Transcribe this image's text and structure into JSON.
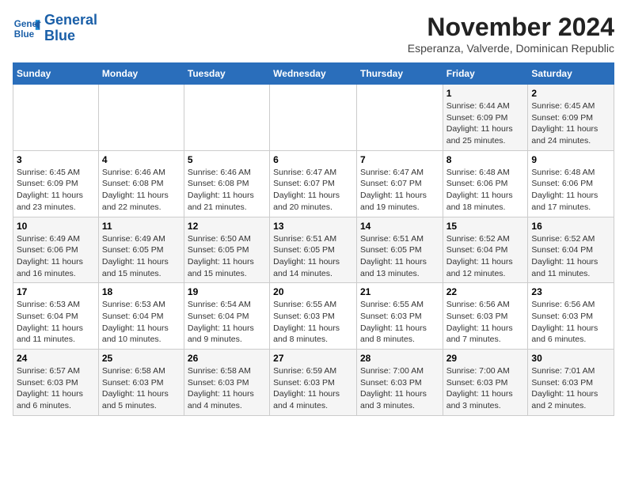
{
  "header": {
    "logo_line1": "General",
    "logo_line2": "Blue",
    "month_year": "November 2024",
    "location": "Esperanza, Valverde, Dominican Republic"
  },
  "days_of_week": [
    "Sunday",
    "Monday",
    "Tuesday",
    "Wednesday",
    "Thursday",
    "Friday",
    "Saturday"
  ],
  "weeks": [
    [
      {
        "day": "",
        "info": ""
      },
      {
        "day": "",
        "info": ""
      },
      {
        "day": "",
        "info": ""
      },
      {
        "day": "",
        "info": ""
      },
      {
        "day": "",
        "info": ""
      },
      {
        "day": "1",
        "info": "Sunrise: 6:44 AM\nSunset: 6:09 PM\nDaylight: 11 hours and 25 minutes."
      },
      {
        "day": "2",
        "info": "Sunrise: 6:45 AM\nSunset: 6:09 PM\nDaylight: 11 hours and 24 minutes."
      }
    ],
    [
      {
        "day": "3",
        "info": "Sunrise: 6:45 AM\nSunset: 6:09 PM\nDaylight: 11 hours and 23 minutes."
      },
      {
        "day": "4",
        "info": "Sunrise: 6:46 AM\nSunset: 6:08 PM\nDaylight: 11 hours and 22 minutes."
      },
      {
        "day": "5",
        "info": "Sunrise: 6:46 AM\nSunset: 6:08 PM\nDaylight: 11 hours and 21 minutes."
      },
      {
        "day": "6",
        "info": "Sunrise: 6:47 AM\nSunset: 6:07 PM\nDaylight: 11 hours and 20 minutes."
      },
      {
        "day": "7",
        "info": "Sunrise: 6:47 AM\nSunset: 6:07 PM\nDaylight: 11 hours and 19 minutes."
      },
      {
        "day": "8",
        "info": "Sunrise: 6:48 AM\nSunset: 6:06 PM\nDaylight: 11 hours and 18 minutes."
      },
      {
        "day": "9",
        "info": "Sunrise: 6:48 AM\nSunset: 6:06 PM\nDaylight: 11 hours and 17 minutes."
      }
    ],
    [
      {
        "day": "10",
        "info": "Sunrise: 6:49 AM\nSunset: 6:06 PM\nDaylight: 11 hours and 16 minutes."
      },
      {
        "day": "11",
        "info": "Sunrise: 6:49 AM\nSunset: 6:05 PM\nDaylight: 11 hours and 15 minutes."
      },
      {
        "day": "12",
        "info": "Sunrise: 6:50 AM\nSunset: 6:05 PM\nDaylight: 11 hours and 15 minutes."
      },
      {
        "day": "13",
        "info": "Sunrise: 6:51 AM\nSunset: 6:05 PM\nDaylight: 11 hours and 14 minutes."
      },
      {
        "day": "14",
        "info": "Sunrise: 6:51 AM\nSunset: 6:05 PM\nDaylight: 11 hours and 13 minutes."
      },
      {
        "day": "15",
        "info": "Sunrise: 6:52 AM\nSunset: 6:04 PM\nDaylight: 11 hours and 12 minutes."
      },
      {
        "day": "16",
        "info": "Sunrise: 6:52 AM\nSunset: 6:04 PM\nDaylight: 11 hours and 11 minutes."
      }
    ],
    [
      {
        "day": "17",
        "info": "Sunrise: 6:53 AM\nSunset: 6:04 PM\nDaylight: 11 hours and 11 minutes."
      },
      {
        "day": "18",
        "info": "Sunrise: 6:53 AM\nSunset: 6:04 PM\nDaylight: 11 hours and 10 minutes."
      },
      {
        "day": "19",
        "info": "Sunrise: 6:54 AM\nSunset: 6:04 PM\nDaylight: 11 hours and 9 minutes."
      },
      {
        "day": "20",
        "info": "Sunrise: 6:55 AM\nSunset: 6:03 PM\nDaylight: 11 hours and 8 minutes."
      },
      {
        "day": "21",
        "info": "Sunrise: 6:55 AM\nSunset: 6:03 PM\nDaylight: 11 hours and 8 minutes."
      },
      {
        "day": "22",
        "info": "Sunrise: 6:56 AM\nSunset: 6:03 PM\nDaylight: 11 hours and 7 minutes."
      },
      {
        "day": "23",
        "info": "Sunrise: 6:56 AM\nSunset: 6:03 PM\nDaylight: 11 hours and 6 minutes."
      }
    ],
    [
      {
        "day": "24",
        "info": "Sunrise: 6:57 AM\nSunset: 6:03 PM\nDaylight: 11 hours and 6 minutes."
      },
      {
        "day": "25",
        "info": "Sunrise: 6:58 AM\nSunset: 6:03 PM\nDaylight: 11 hours and 5 minutes."
      },
      {
        "day": "26",
        "info": "Sunrise: 6:58 AM\nSunset: 6:03 PM\nDaylight: 11 hours and 4 minutes."
      },
      {
        "day": "27",
        "info": "Sunrise: 6:59 AM\nSunset: 6:03 PM\nDaylight: 11 hours and 4 minutes."
      },
      {
        "day": "28",
        "info": "Sunrise: 7:00 AM\nSunset: 6:03 PM\nDaylight: 11 hours and 3 minutes."
      },
      {
        "day": "29",
        "info": "Sunrise: 7:00 AM\nSunset: 6:03 PM\nDaylight: 11 hours and 3 minutes."
      },
      {
        "day": "30",
        "info": "Sunrise: 7:01 AM\nSunset: 6:03 PM\nDaylight: 11 hours and 2 minutes."
      }
    ]
  ]
}
